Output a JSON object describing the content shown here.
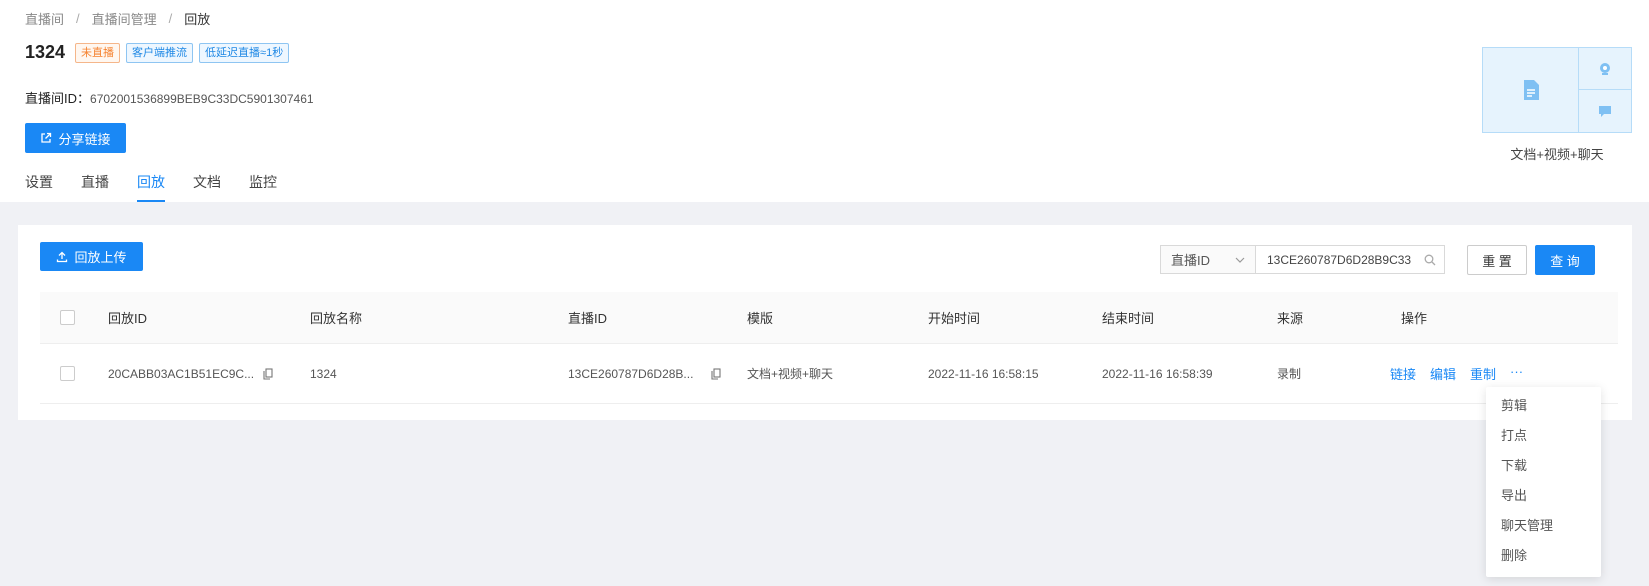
{
  "breadcrumb": [
    "直播间",
    "直播间管理",
    "回放"
  ],
  "room": {
    "title": "1324",
    "tags": [
      "未直播",
      "客户端推流",
      "低延迟直播≈1秒"
    ],
    "id_label": "直播间ID：",
    "id_value": "6702001536899BEB9C33DC5901307461"
  },
  "share_button": "分享链接",
  "tabs": [
    "设置",
    "直播",
    "回放",
    "文档",
    "监控"
  ],
  "active_tab": "回放",
  "layout_caption": "文档+视频+聊天",
  "toolbar": {
    "upload_label": "回放上传",
    "filter_select": "直播ID",
    "filter_value": "13CE260787D6D28B9C33",
    "reset_label": "重 置",
    "query_label": "查 询"
  },
  "table": {
    "headers": [
      "回放ID",
      "回放名称",
      "直播ID",
      "模版",
      "开始时间",
      "结束时间",
      "来源",
      "操作"
    ],
    "rows": [
      {
        "replay_id": "20CABB03AC1B51EC9C...",
        "name": "1324",
        "live_id": "13CE260787D6D28B...",
        "template": "文档+视频+聊天",
        "start": "2022-11-16 16:58:15",
        "end": "2022-11-16 16:58:39",
        "source": "录制",
        "actions": [
          "链接",
          "编辑",
          "重制",
          "···"
        ]
      }
    ]
  },
  "more_menu": [
    "剪辑",
    "打点",
    "下载",
    "导出",
    "聊天管理",
    "删除"
  ],
  "colors": {
    "primary": "#1a88f5",
    "orange_tag": "#f5822f"
  }
}
